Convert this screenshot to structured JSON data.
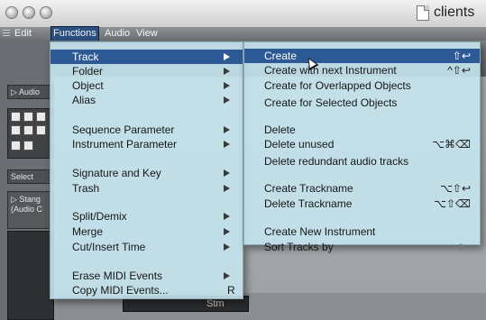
{
  "window": {
    "title": "clients",
    "traffic_lights": [
      "close-light",
      "minimize-light",
      "zoom-light"
    ]
  },
  "menubar": {
    "items": [
      {
        "label": "Edit"
      },
      {
        "label": "Functions"
      },
      {
        "label": "Audio"
      },
      {
        "label": "View"
      }
    ],
    "active": "Functions"
  },
  "left_panel": {
    "audio_field": "Audio",
    "select_field": "Select",
    "stang_line1": "Stang",
    "stang_line2": "(Audio C"
  },
  "bottom_bar": {
    "lcd_text": "Stm"
  },
  "functions_menu": {
    "items": [
      {
        "label": "Track",
        "submenu": true,
        "highlighted": true
      },
      {
        "label": "Folder",
        "submenu": true
      },
      {
        "label": "Object",
        "submenu": true
      },
      {
        "label": "Alias",
        "submenu": true
      },
      {
        "label": "Sequence Parameter",
        "submenu": true
      },
      {
        "label": "Instrument Parameter",
        "submenu": true
      },
      {
        "label": "Signature and Key",
        "submenu": true
      },
      {
        "label": "Trash",
        "submenu": true
      },
      {
        "label": "Split/Demix",
        "submenu": true
      },
      {
        "label": "Merge",
        "submenu": true
      },
      {
        "label": "Cut/Insert Time",
        "submenu": true
      },
      {
        "label": "Erase MIDI Events",
        "submenu": true
      },
      {
        "label": "Copy MIDI Events...",
        "key": "R"
      }
    ]
  },
  "track_submenu": {
    "items": [
      {
        "label": "Create",
        "shortcut": "⇧↩",
        "highlighted": true
      },
      {
        "label": "Create with next Instrument",
        "shortcut": "^⇧↩"
      },
      {
        "label": "Create for Overlapped Objects"
      },
      {
        "label": "Create for Selected Objects"
      },
      {
        "label": "Delete"
      },
      {
        "label": "Delete unused",
        "shortcut": "⌥⌘⌫"
      },
      {
        "label": "Delete redundant audio tracks"
      },
      {
        "label": "Create Trackname",
        "shortcut": "⌥⇧↩"
      },
      {
        "label": "Delete Trackname",
        "shortcut": "⌥⇧⌫"
      },
      {
        "label": "Create New Instrument"
      },
      {
        "label": "Sort Tracks by",
        "submenu": true
      }
    ]
  },
  "colors": {
    "menu_bg": "#c4e4ee",
    "highlight": "#2d5a97",
    "menubar_active": "#2b4f7e"
  }
}
